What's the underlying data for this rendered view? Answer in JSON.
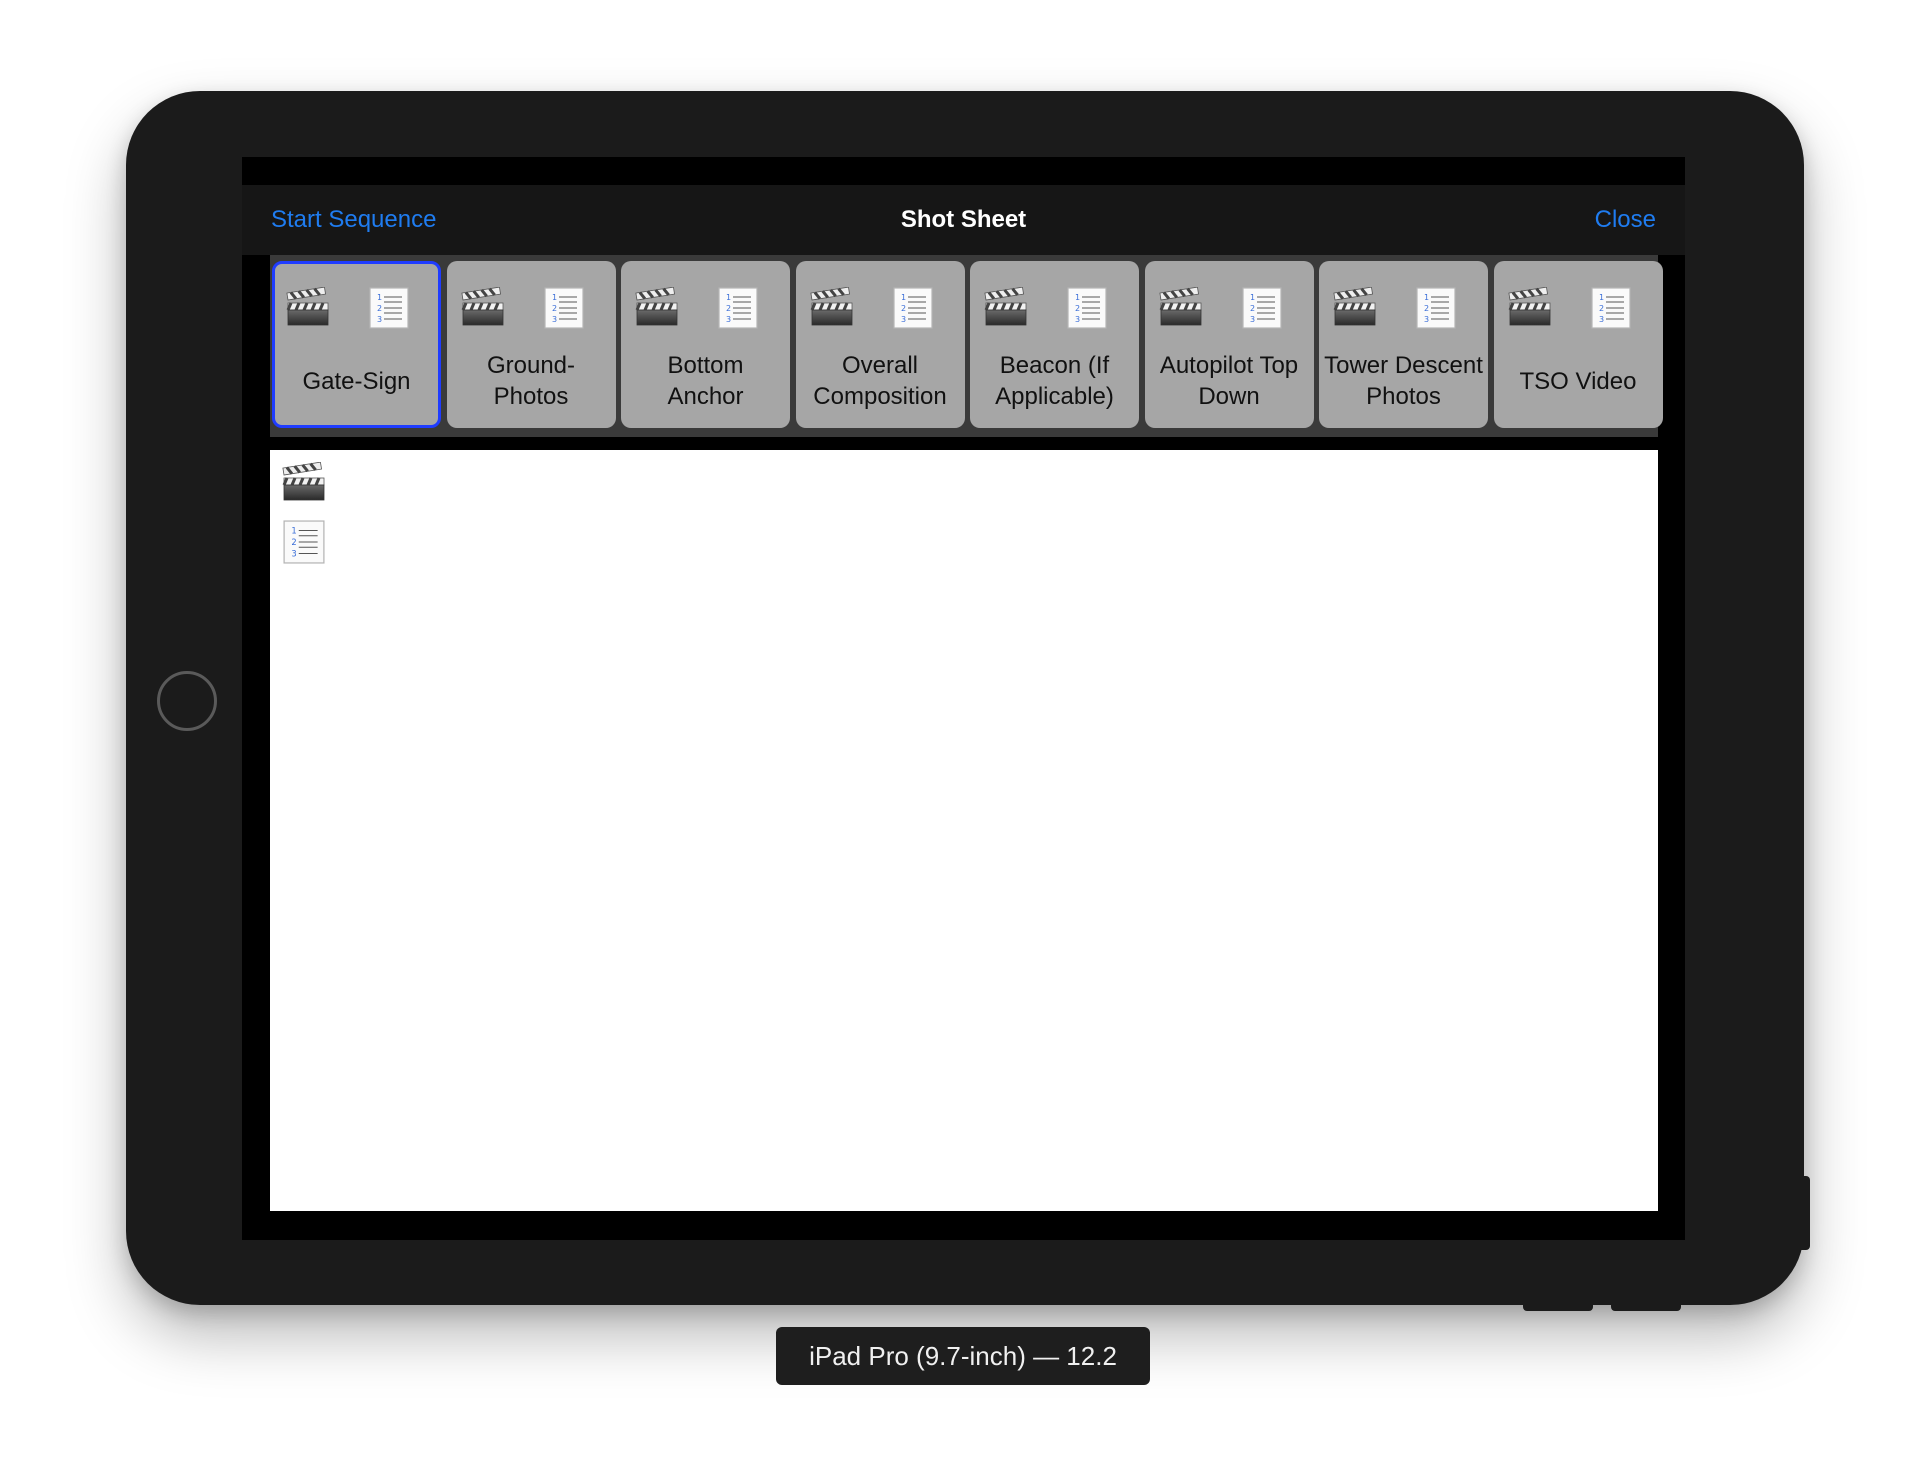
{
  "navbar": {
    "left_label": "Start Sequence",
    "title": "Shot Sheet",
    "right_label": "Close"
  },
  "tabs": [
    {
      "label": "Gate-Sign",
      "selected": true
    },
    {
      "label": "Ground-\nPhotos",
      "selected": false
    },
    {
      "label": "Bottom\nAnchor",
      "selected": false
    },
    {
      "label": "Overall\nComposition",
      "selected": false
    },
    {
      "label": "Beacon (If\nApplicable)",
      "selected": false
    },
    {
      "label": "Autopilot Top\nDown",
      "selected": false
    },
    {
      "label": "Tower Descent\nPhotos",
      "selected": false
    },
    {
      "label": "TSO Video",
      "selected": false
    }
  ],
  "icons": {
    "clapper": "clapperboard-icon",
    "list": "numbered-list-icon"
  },
  "colors": {
    "accent": "#1f7cf0",
    "selected_border": "#1f3cff",
    "tab_bg": "#a6a6a6"
  },
  "simulator_label": "iPad Pro (9.7-inch) — 12.2"
}
